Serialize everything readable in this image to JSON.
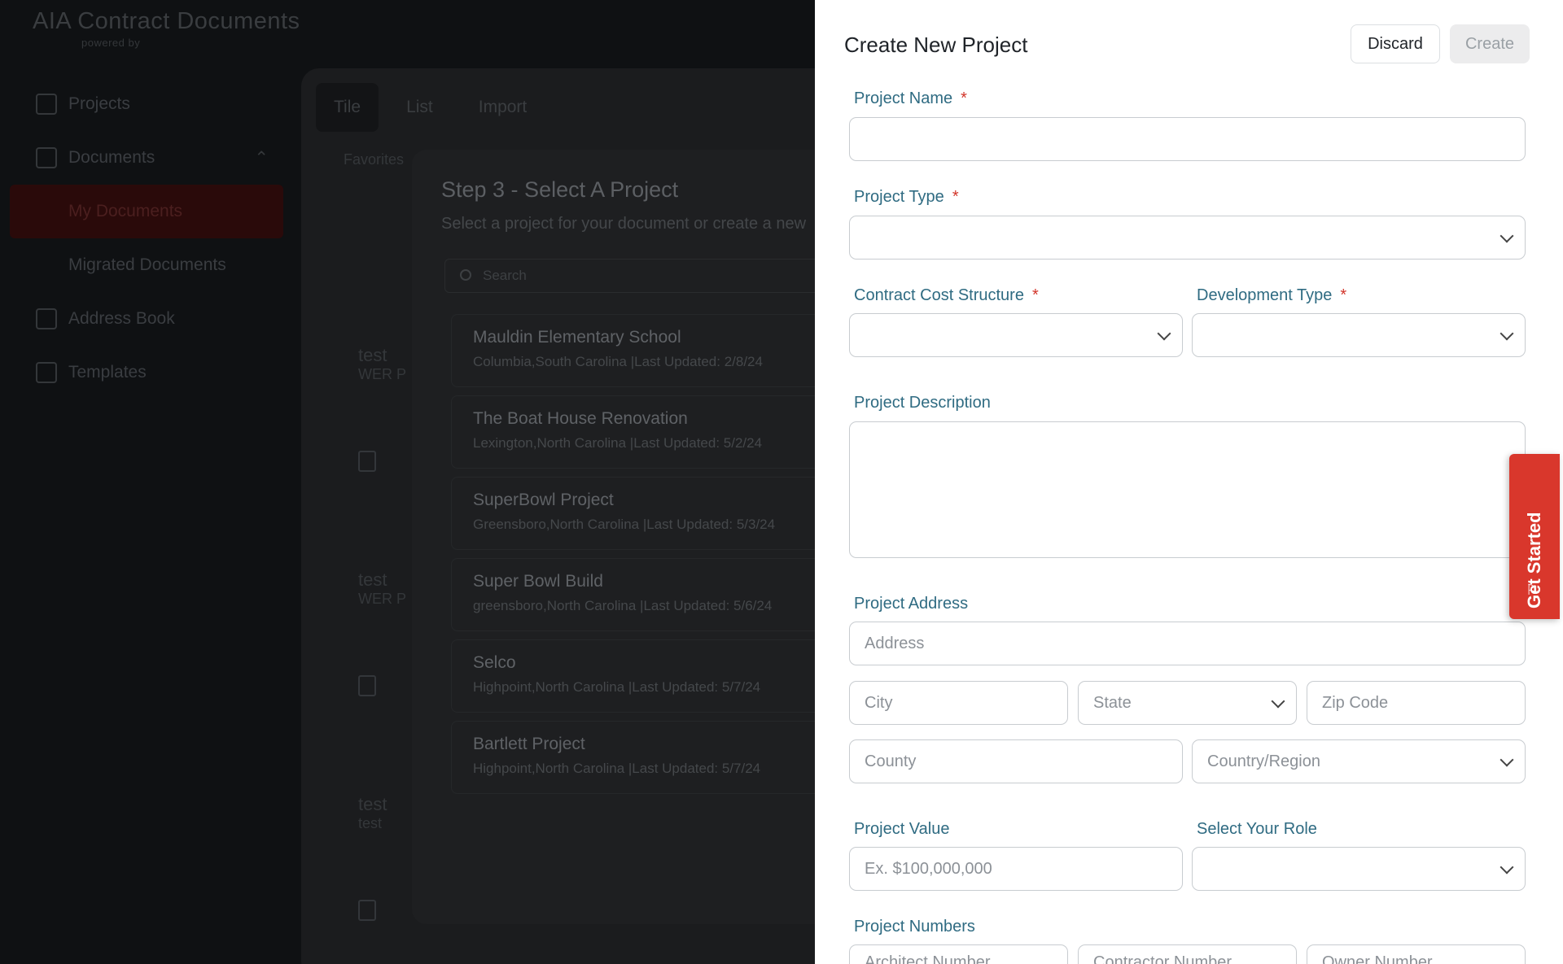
{
  "background": {
    "logo": "AIA Contract Documents",
    "logo_sub": "powered by",
    "sidebar": [
      {
        "label": "Projects"
      },
      {
        "label": "Documents"
      },
      {
        "label": "My Documents"
      },
      {
        "label": "Migrated Documents"
      },
      {
        "label": "Address Book"
      },
      {
        "label": "Templates"
      }
    ],
    "tabs": [
      "Tile",
      "List",
      "Import"
    ],
    "favorites": "Favorites",
    "cards": [
      {
        "title": "test",
        "sub": "WER P"
      },
      {
        "title": "test",
        "sub": "WER P"
      },
      {
        "title": "test",
        "sub": "test"
      }
    ]
  },
  "step_modal": {
    "title": "Step 3 - Select A Project",
    "subtitle": "Select a project for your document or create a new",
    "search_placeholder": "Search",
    "projects": [
      {
        "name": "Mauldin Elementary School",
        "meta": "Columbia,South Carolina |Last Updated: 2/8/24"
      },
      {
        "name": "The Boat House Renovation",
        "meta": "Lexington,North Carolina |Last Updated: 5/2/24"
      },
      {
        "name": "SuperBowl Project",
        "meta": "Greensboro,North Carolina |Last Updated: 5/3/24"
      },
      {
        "name": "Super Bowl Build",
        "meta": "greensboro,North Carolina |Last Updated: 5/6/24"
      },
      {
        "name": "Selco",
        "meta": "Highpoint,North Carolina |Last Updated: 5/7/24"
      },
      {
        "name": "Bartlett Project",
        "meta": "Highpoint,North Carolina |Last Updated: 5/7/24"
      }
    ]
  },
  "drawer": {
    "title": "Create New Project",
    "discard_label": "Discard",
    "create_label": "Create",
    "required_mark": "*",
    "labels": {
      "project_name": "Project Name",
      "project_type": "Project Type",
      "contract_cost_structure": "Contract Cost Structure",
      "development_type": "Development Type",
      "project_description": "Project Description",
      "project_address": "Project Address",
      "project_value": "Project Value",
      "select_your_role": "Select Your Role",
      "project_numbers": "Project Numbers"
    },
    "placeholders": {
      "address": "Address",
      "city": "City",
      "state": "State",
      "zip": "Zip Code",
      "county": "County",
      "country": "Country/Region",
      "project_value": "Ex. $100,000,000",
      "architect_number": "Architect Number",
      "contractor_number": "Contractor Number",
      "owner_number": "Owner Number"
    }
  },
  "get_started": "Get Started",
  "colors": {
    "accent": "#d9372c",
    "label": "#2f6b82"
  }
}
